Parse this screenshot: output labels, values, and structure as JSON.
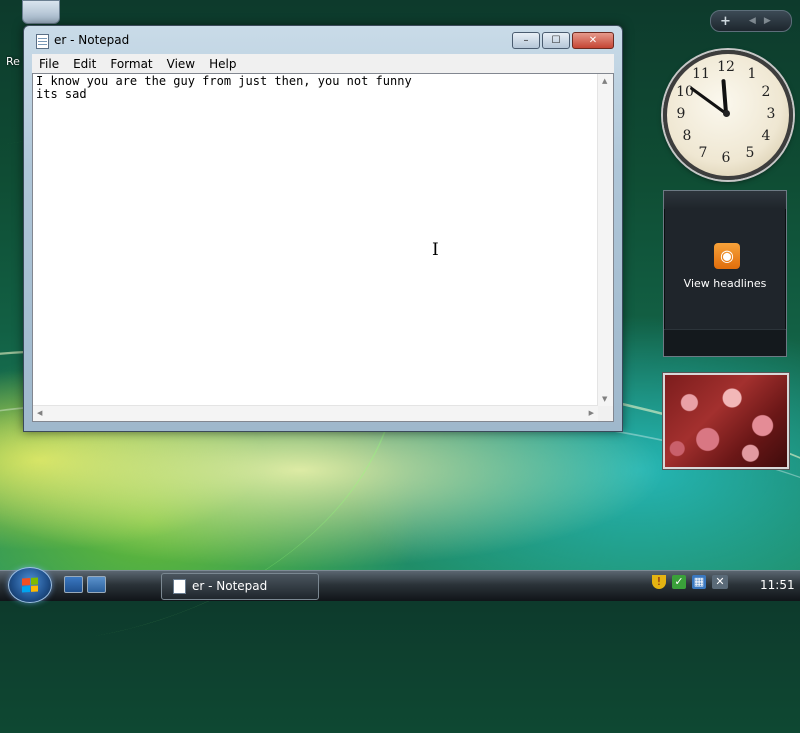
{
  "desktop": {
    "recycle_bin_label": "Re"
  },
  "notepad": {
    "title": "er - Notepad",
    "controls": {
      "minimize": "–",
      "maximize": "☐",
      "close": "✕"
    },
    "menu": [
      "File",
      "Edit",
      "Format",
      "View",
      "Help"
    ],
    "content": "I know you are the guy from just then, you not funny\nits sad"
  },
  "sidebar": {
    "controls": {
      "add": "+",
      "prev": "◀",
      "next": "▶"
    },
    "clock": {
      "time": "11:51",
      "numbers": [
        "12",
        "1",
        "2",
        "3",
        "4",
        "5",
        "6",
        "7",
        "8",
        "9",
        "10",
        "11"
      ]
    },
    "feed": {
      "label": "View headlines",
      "icon": "rss-icon"
    },
    "slideshow": {
      "icon": "photo-slideshow"
    }
  },
  "taskbar": {
    "start_icon": "windows-flag-icon",
    "quick_launch": [
      "show-desktop-icon",
      "switch-windows-icon"
    ],
    "task_label": "er - Notepad",
    "tray_icons": [
      "shield-icon",
      "sync-icon",
      "network-icon",
      "volume-muted-icon"
    ],
    "time": "11:51"
  },
  "colors": {
    "accent": "#1f4f8a",
    "close_button": "#c54534",
    "rss": "#f29229"
  }
}
